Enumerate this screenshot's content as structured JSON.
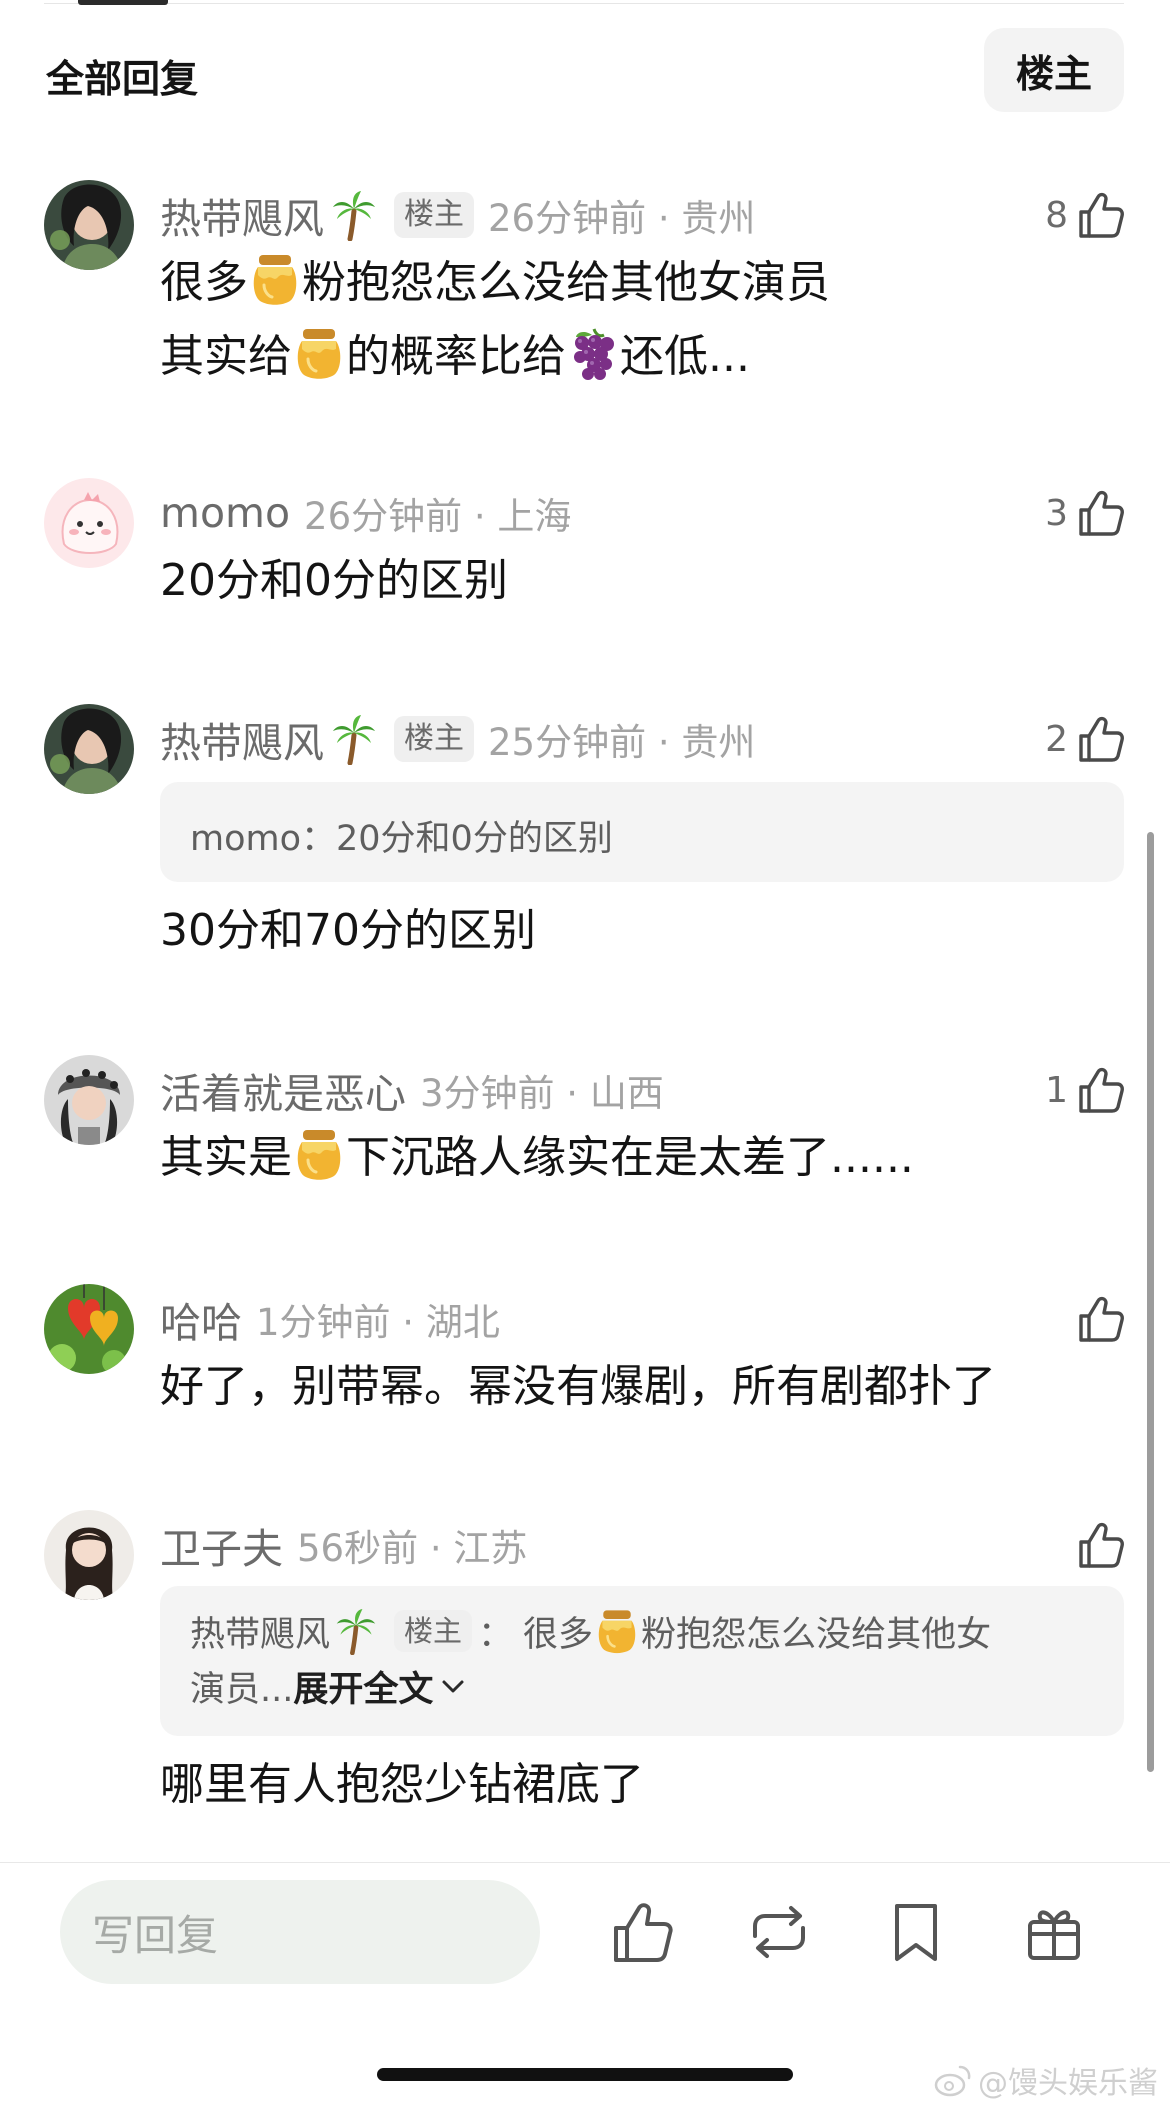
{
  "header": {
    "title": "全部回复",
    "op_filter_label": "楼主"
  },
  "comments": [
    {
      "user": "热带飓风",
      "op_badge": "楼主",
      "time_loc": "26分钟前 · 贵州",
      "likes": "8",
      "body_line1_a": "很多",
      "body_line1_b": "粉抱怨怎么没给其他女演员",
      "body_line2_a": "其实给",
      "body_line2_b": "的概率比给",
      "body_line2_c": "还低..."
    },
    {
      "user": "momo",
      "time_loc": "26分钟前 · 上海",
      "likes": "3",
      "body": "20分和0分的区别"
    },
    {
      "user": "热带飓风",
      "op_badge": "楼主",
      "time_loc": "25分钟前 · 贵州",
      "likes": "2",
      "quote": "momo：20分和0分的区别",
      "body": "30分和70分的区别"
    },
    {
      "user": "活着就是恶心",
      "time_loc": "3分钟前 · 山西",
      "likes": "1",
      "body_a": "其实是",
      "body_b": "下沉路人缘实在是太差了......"
    },
    {
      "user": "哈哈",
      "time_loc": "1分钟前 · 湖北",
      "likes": "",
      "body": "好了，别带幂。幂没有爆剧，所有剧都扑了"
    },
    {
      "user": "卫子夫",
      "time_loc": "56秒前 · 江苏",
      "likes": "",
      "quote_user": "热带飓风",
      "quote_badge": "楼主",
      "quote_sep": "：",
      "quote_a": "很多",
      "quote_b": "粉抱怨怎么没给其他女",
      "quote_line2": "演员...",
      "quote_expand": "展开全文",
      "body": "哪里有人抱怨少钻裙底了"
    }
  ],
  "bottom_bar": {
    "reply_placeholder": "写回复",
    "icons": [
      "like-icon",
      "repost-icon",
      "bookmark-icon",
      "gift-icon"
    ]
  },
  "watermark": "@馒头娱乐酱",
  "colors": {
    "username": "#6b6b6b",
    "meta": "#a3a3a3",
    "badge_bg": "#efefef",
    "quote_bg": "#f4f4f4",
    "input_bg": "#eef2ee"
  }
}
